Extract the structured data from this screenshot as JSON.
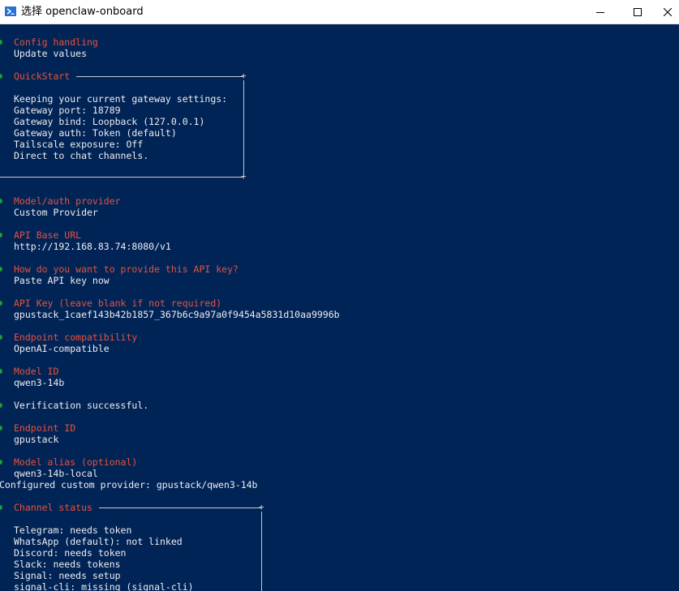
{
  "window": {
    "title": "选择 openclaw-onboard",
    "min_icon": "minimize-icon",
    "max_icon": "maximize-icon",
    "close_icon": "close-icon"
  },
  "prompts": [
    {
      "label": "Config handling",
      "answer": "Update values"
    },
    {
      "label": "Model/auth provider",
      "answer": "Custom Provider"
    },
    {
      "label": "API Base URL",
      "answer": "http://192.168.83.74:8080/v1"
    },
    {
      "label": "How do you want to provide this API key?",
      "answer": "Paste API key now"
    },
    {
      "label": "API Key (leave blank if not required)",
      "answer": "gpustack_1caef143b42b1857_367b6c9a97a0f9454a5831d10aa9996b"
    },
    {
      "label": "Endpoint compatibility",
      "answer": "OpenAI-compatible"
    },
    {
      "label": "Model ID",
      "answer": "qwen3-14b"
    },
    {
      "label": "Endpoint ID",
      "answer": "gpustack"
    },
    {
      "label": "Model alias (optional)",
      "answer": "qwen3-14b-local"
    }
  ],
  "quickstart": {
    "title": "QuickStart",
    "lines": [
      "Keeping your current gateway settings:",
      "Gateway port: 18789",
      "Gateway bind: Loopback (127.0.0.1)",
      "Gateway auth: Token (default)",
      "Tailscale exposure: Off",
      "Direct to chat channels."
    ]
  },
  "verification": "Verification successful.",
  "configured": "Configured custom provider: gpustack/qwen3-14b",
  "channel_status": {
    "title": "Channel status",
    "lines": [
      "Telegram: needs token",
      "WhatsApp (default): not linked",
      "Discord: needs token",
      "Slack: needs tokens",
      "Signal: needs setup",
      "signal-cli: missing (signal-cli)"
    ]
  },
  "colors": {
    "background": "#012456",
    "text": "#eeedf0",
    "header": "#e8513d",
    "bullet": "#1f9e2f"
  }
}
